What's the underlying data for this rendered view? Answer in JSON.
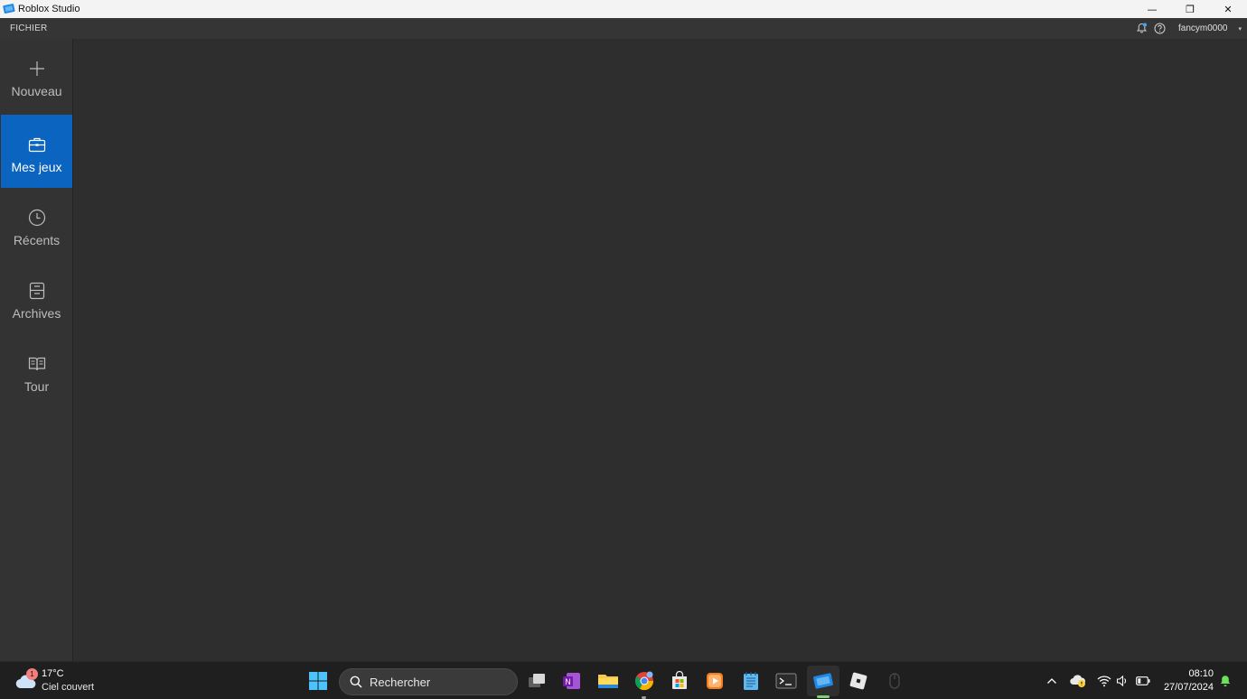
{
  "window": {
    "title": "Roblox Studio",
    "controls": {
      "minimize": "—",
      "restore": "❐",
      "close": "✕"
    }
  },
  "menubar": {
    "file_label": "FICHIER",
    "username": "fancym0000",
    "user_caret": "▾"
  },
  "sidebar": {
    "items": [
      {
        "label": "Nouveau",
        "icon": "plus-icon",
        "active": false
      },
      {
        "label": "Mes jeux",
        "icon": "briefcase-icon",
        "active": true
      },
      {
        "label": "Récents",
        "icon": "clock-icon",
        "active": false
      },
      {
        "label": "Archives",
        "icon": "archive-icon",
        "active": false
      },
      {
        "label": "Tour",
        "icon": "book-icon",
        "active": false
      }
    ]
  },
  "taskbar": {
    "weather": {
      "badge": "1",
      "temp": "17°C",
      "desc": "Ciel couvert"
    },
    "search_label": "Rechercher",
    "clock": {
      "time": "08:10",
      "date": "27/07/2024"
    }
  },
  "colors": {
    "accent": "#0b64c0",
    "background": "#2e2e2e",
    "sidebar": "#333333",
    "taskbar": "#1f1f1f"
  }
}
